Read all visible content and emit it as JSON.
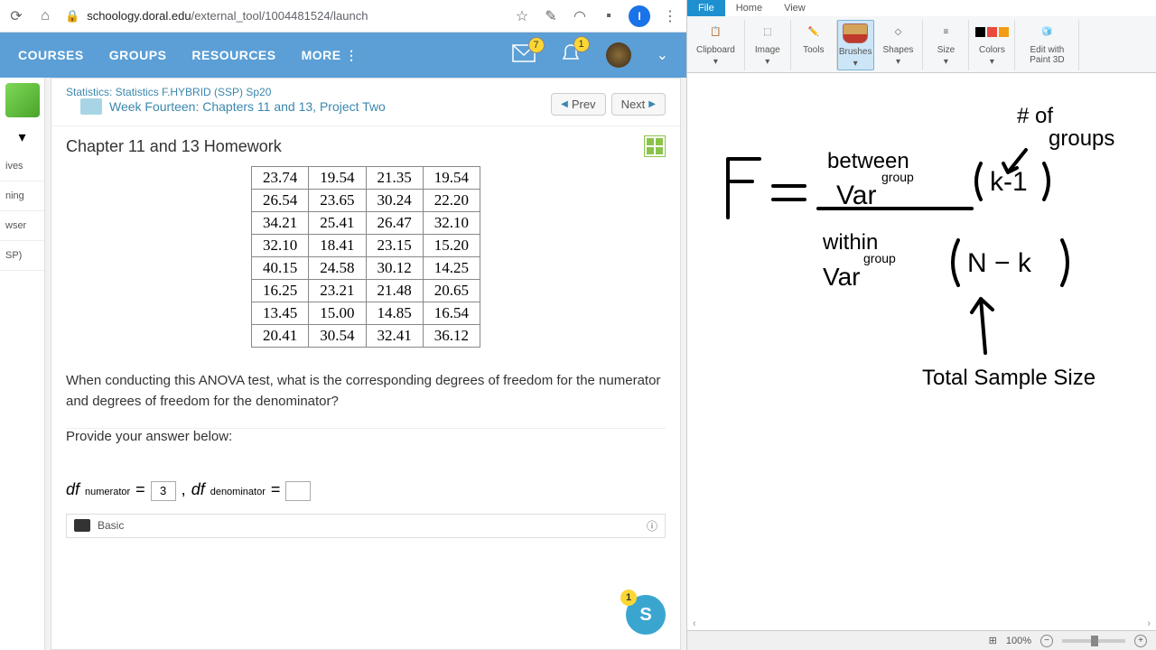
{
  "browser": {
    "url_domain": "schoology.doral.edu",
    "url_path": "/external_tool/1004481524/launch",
    "avatar_letter": "I"
  },
  "nav": {
    "courses": "COURSES",
    "groups": "GROUPS",
    "resources": "RESOURCES",
    "more": "MORE",
    "mail_badge": "7",
    "notif_badge": "1"
  },
  "sidebar": {
    "items": [
      "ives",
      "ning",
      "wser",
      "SP)"
    ]
  },
  "breadcrumb": {
    "course": "Statistics: Statistics F.HYBRID (SSP) Sp20",
    "folder": "Week Fourteen: Chapters 11 and 13, Project Two",
    "prev": "Prev",
    "next": "Next"
  },
  "hw": {
    "title": "Chapter 11 and 13 Homework",
    "question": "When conducting this ANOVA test, what is the corresponding degrees of freedom for the numerator and degrees of freedom for the denominator?",
    "answer_label": "Provide your answer below:",
    "df_num_label": "numerator",
    "df_den_label": "denominator",
    "df_num_value": "3",
    "kb_mode": "Basic"
  },
  "table": [
    [
      "23.74",
      "19.54",
      "21.35",
      "19.54"
    ],
    [
      "26.54",
      "23.65",
      "30.24",
      "22.20"
    ],
    [
      "34.21",
      "25.41",
      "26.47",
      "32.10"
    ],
    [
      "32.10",
      "18.41",
      "23.15",
      "15.20"
    ],
    [
      "40.15",
      "24.58",
      "30.12",
      "14.25"
    ],
    [
      "16.25",
      "23.21",
      "21.48",
      "20.65"
    ],
    [
      "13.45",
      "15.00",
      "14.85",
      "16.54"
    ],
    [
      "20.41",
      "30.54",
      "32.41",
      "36.12"
    ]
  ],
  "paint": {
    "tabs": {
      "file": "File",
      "home": "Home",
      "view": "View"
    },
    "groups": {
      "clipboard": "Clipboard",
      "image": "Image",
      "tools": "Tools",
      "brushes": "Brushes",
      "shapes": "Shapes",
      "size": "Size",
      "colors": "Colors",
      "edit3d": "Edit with Paint 3D"
    },
    "zoom": "100%"
  },
  "chat": {
    "letter": "S",
    "badge": "1"
  },
  "chart_data": {
    "type": "table",
    "title": "ANOVA formula sketch",
    "notes": [
      "F = between-group Var / within-group Var",
      "numerator df = (k - 1)  — # of groups",
      "denominator df = (N - k) — Total sample size"
    ]
  }
}
